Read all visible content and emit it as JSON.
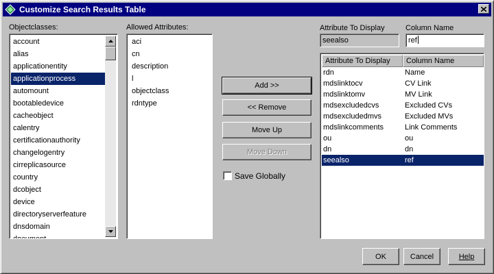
{
  "window": {
    "title": "Customize Search Results Table",
    "app_icon": "directory-app-icon",
    "close_icon": "close-icon"
  },
  "objectclasses": {
    "label": "Objectclasses:",
    "items": [
      "account",
      "alias",
      "applicationentity",
      "applicationprocess",
      "automount",
      "bootabledevice",
      "cacheobject",
      "calentry",
      "certificationauthority",
      "changelogentry",
      "cirreplicasource",
      "country",
      "dcobject",
      "device",
      "directoryserverfeature",
      "dnsdomain",
      "document"
    ],
    "selected": "applicationprocess"
  },
  "allowed_attributes": {
    "label": "Allowed Attributes:",
    "items": [
      "aci",
      "cn",
      "description",
      "l",
      "objectclass",
      "rdntype"
    ]
  },
  "buttons": {
    "add": "Add >>",
    "remove": "<< Remove",
    "move_up": "Move Up",
    "move_down": "Move Down",
    "ok": "OK",
    "cancel": "Cancel",
    "help": "Help"
  },
  "save_globally": {
    "label": "Save Globally",
    "checked": false
  },
  "attribute_to_display": {
    "label": "Attribute To Display",
    "value": "seealso"
  },
  "column_name": {
    "label": "Column Name",
    "value": "ref"
  },
  "table": {
    "headers": [
      "Attribute To Display",
      "Column Name"
    ],
    "rows": [
      {
        "attr": "rdn",
        "col": "Name"
      },
      {
        "attr": "mdslinktocv",
        "col": "CV Link"
      },
      {
        "attr": "mdslinktomv",
        "col": "MV Link"
      },
      {
        "attr": "mdsexcludedcvs",
        "col": "Excluded CVs"
      },
      {
        "attr": "mdsexcludedmvs",
        "col": "Excluded MVs"
      },
      {
        "attr": "mdslinkcomments",
        "col": "Link Comments"
      },
      {
        "attr": "ou",
        "col": "ou"
      },
      {
        "attr": "dn",
        "col": "dn"
      },
      {
        "attr": "seealso",
        "col": "ref"
      }
    ],
    "selected_index": 8
  },
  "colors": {
    "title_bar": "#000080",
    "selection": "#0a246a",
    "face": "#c0c0c0"
  }
}
